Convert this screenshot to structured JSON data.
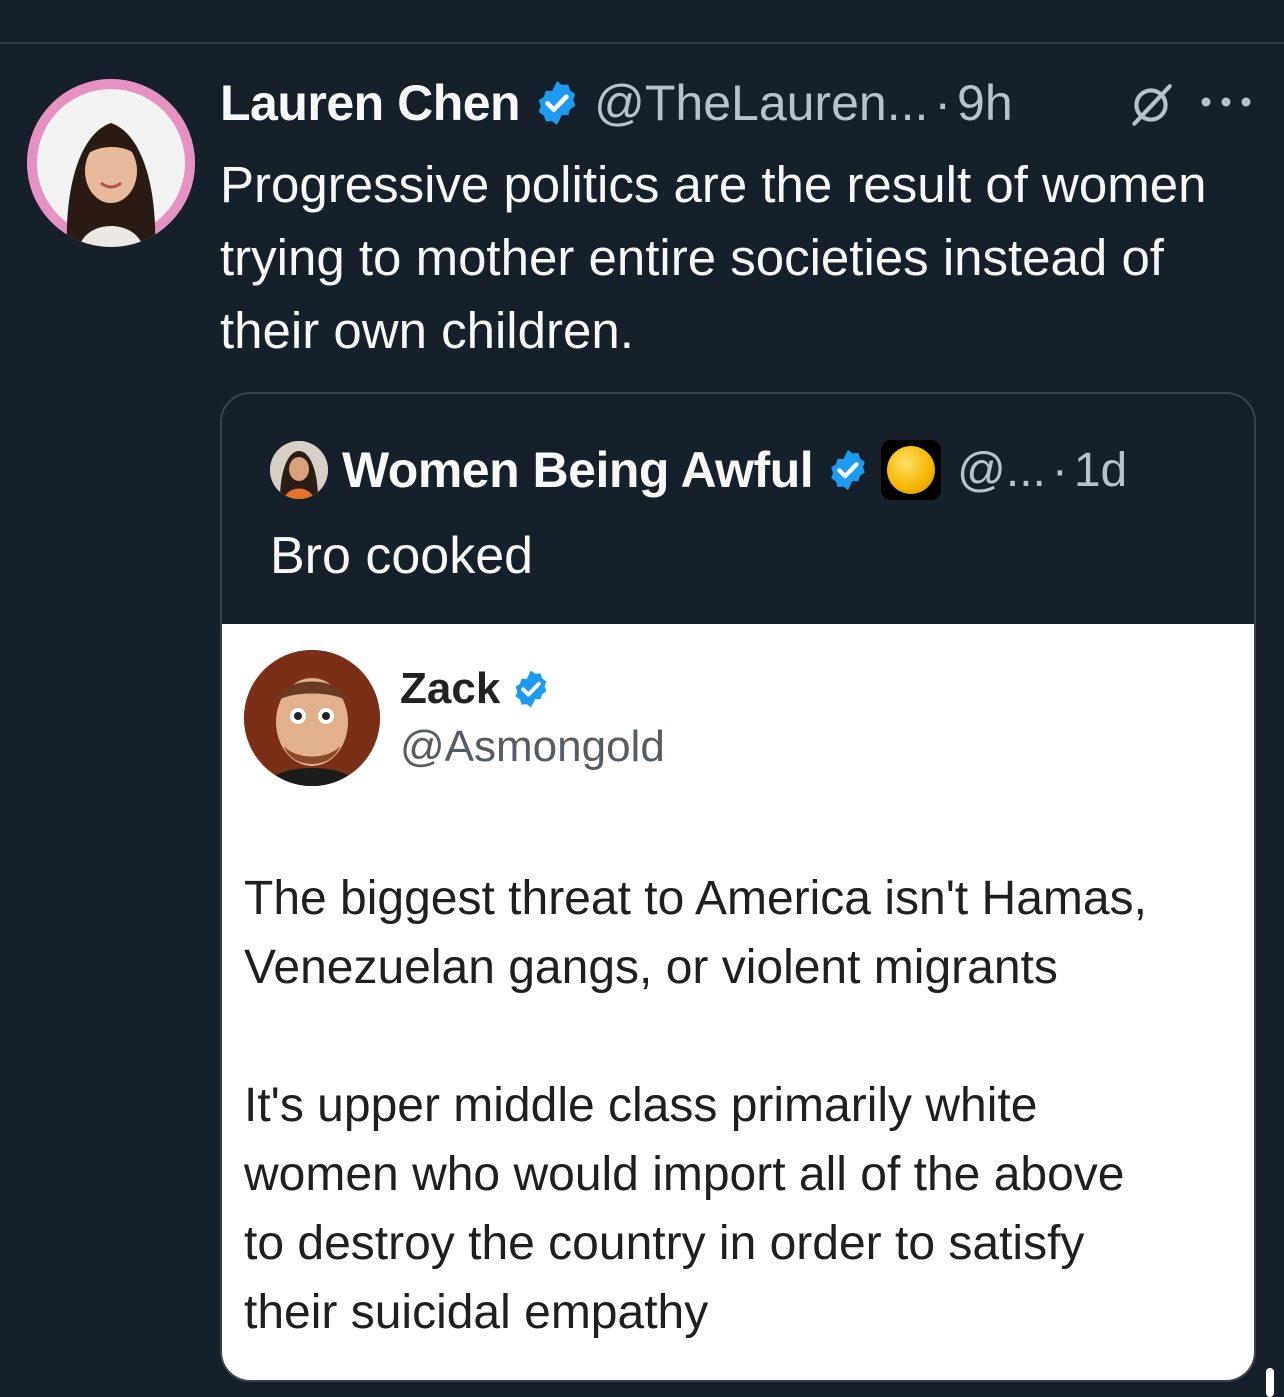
{
  "tweet": {
    "display_name": "Lauren Chen",
    "handle": "@TheLauren...",
    "separator": "·",
    "time": "9h",
    "text": "Progressive politics are the result of women trying to mother entire societies instead of their own children.",
    "icons": {
      "verified": "verified-badge-icon",
      "grok": "grok-icon",
      "more": "more-options-icon"
    }
  },
  "quote": {
    "display_name": "Women Being Awful",
    "handle": "@...",
    "separator": "·",
    "time": "1d",
    "text": "Bro cooked",
    "badge_icon": "yellow-circle-emoji-icon"
  },
  "media": {
    "author_name": "Zack",
    "author_handle": "@Asmongold",
    "paragraphs": [
      "The biggest threat to America isn't Hamas,\nVenezuelan gangs, or violent migrants",
      "It's upper middle class primarily white\nwomen who would import all of the above\nto destroy the country in order to satisfy\ntheir suicidal empathy"
    ]
  },
  "colors": {
    "background": "#15202b",
    "text_primary": "#f7f9f9",
    "text_secondary": "#b8c2cc",
    "verified_blue": "#1d9bf0",
    "card_border": "#38444d"
  }
}
